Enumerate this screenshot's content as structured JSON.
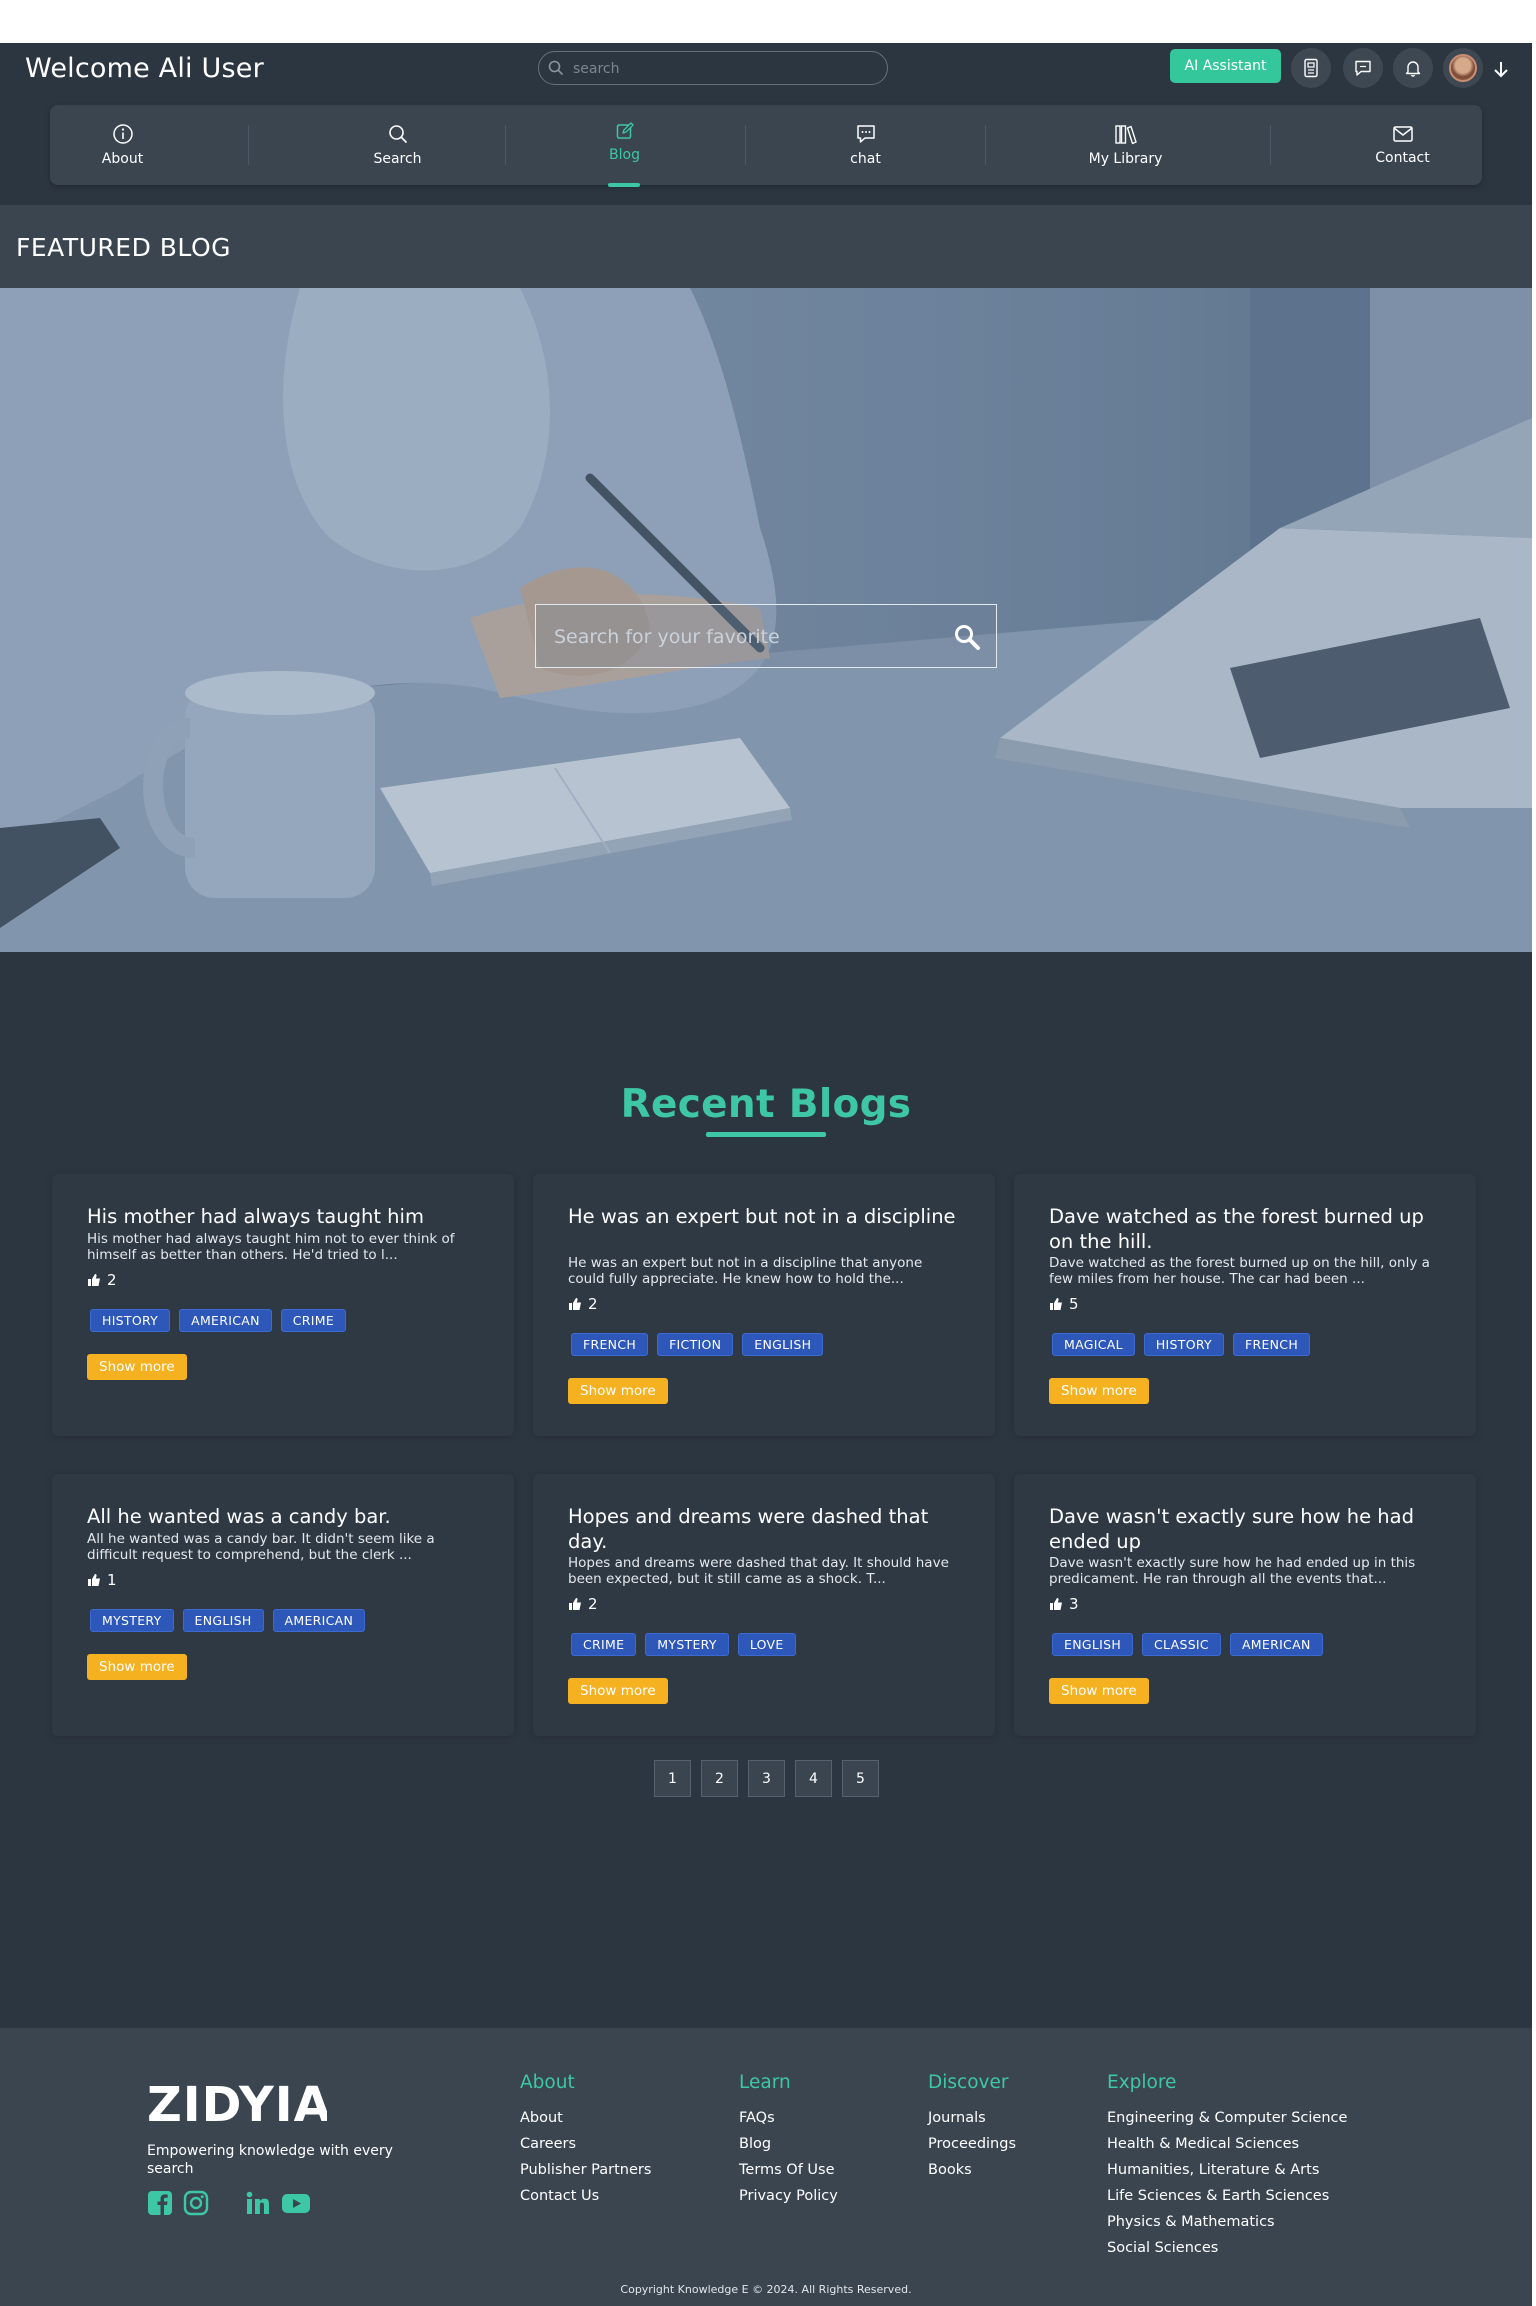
{
  "header": {
    "welcome": "Welcome Ali User",
    "search_placeholder": "search",
    "ai_button": "AI Assistant",
    "icons": [
      "document-icon",
      "message-icon",
      "bell-icon",
      "avatar",
      "arrow-down-icon"
    ]
  },
  "nav": {
    "items": [
      {
        "label": "About",
        "icon": "info-icon"
      },
      {
        "label": "Search",
        "icon": "search-icon"
      },
      {
        "label": "Blog",
        "icon": "edit-icon",
        "active": true
      },
      {
        "label": "chat",
        "icon": "chat-icon"
      },
      {
        "label": "My Library",
        "icon": "library-icon"
      },
      {
        "label": "Contact",
        "icon": "mail-icon"
      }
    ]
  },
  "featured": {
    "title": "FEATURED BLOG",
    "search_placeholder": "Search for your favorite"
  },
  "blogs": {
    "title": "Recent Blogs",
    "show_more": "Show more",
    "cards": [
      {
        "title": "His mother had always taught him",
        "excerpt": "His mother had always taught him not to ever think of himself as better than others. He'd tried to l...",
        "likes": "2",
        "tags": [
          "HISTORY",
          "AMERICAN",
          "CRIME"
        ]
      },
      {
        "title": "He was an expert but not in a discipline",
        "excerpt": "He was an expert but not in a discipline that anyone could fully appreciate. He knew how to hold the...",
        "likes": "2",
        "tags": [
          "FRENCH",
          "FICTION",
          "ENGLISH"
        ]
      },
      {
        "title": "Dave watched as the forest burned up on the hill.",
        "excerpt": "Dave watched as the forest burned up on the hill, only a few miles from her house. The car had been ...",
        "likes": "5",
        "tags": [
          "MAGICAL",
          "HISTORY",
          "FRENCH"
        ]
      },
      {
        "title": "All he wanted was a candy bar.",
        "excerpt": "All he wanted was a candy bar. It didn't seem like a difficult request to comprehend, but the clerk ...",
        "likes": "1",
        "tags": [
          "MYSTERY",
          "ENGLISH",
          "AMERICAN"
        ]
      },
      {
        "title": "Hopes and dreams were dashed that day.",
        "excerpt": "Hopes and dreams were dashed that day. It should have been expected, but it still came as a shock. T...",
        "likes": "2",
        "tags": [
          "CRIME",
          "MYSTERY",
          "LOVE"
        ]
      },
      {
        "title": "Dave wasn't exactly sure how he had ended up",
        "excerpt": "Dave wasn't exactly sure how he had ended up in this predicament. He ran through all the events that...",
        "likes": "3",
        "tags": [
          "ENGLISH",
          "CLASSIC",
          "AMERICAN"
        ]
      }
    ],
    "pages": [
      "1",
      "2",
      "3",
      "4",
      "5"
    ]
  },
  "footer": {
    "brand": "ZIDYIA",
    "tagline": "Empowering knowledge with every search",
    "socials": [
      "facebook-icon",
      "instagram-icon",
      "linkedin-icon",
      "youtube-icon"
    ],
    "columns": [
      {
        "title": "About",
        "links": [
          "About",
          "Careers",
          "Publisher Partners",
          "Contact Us"
        ]
      },
      {
        "title": "Learn",
        "links": [
          "FAQs",
          "Blog",
          "Terms Of Use",
          "Privacy Policy"
        ]
      },
      {
        "title": "Discover",
        "links": [
          "Journals",
          "Proceedings",
          "Books"
        ]
      },
      {
        "title": "Explore",
        "links": [
          "Engineering & Computer Science",
          "Health & Medical Sciences",
          "Humanities, Literature & Arts",
          "Life Sciences & Earth Sciences",
          "Physics & Mathematics",
          "Social Sciences"
        ]
      }
    ],
    "copyright": "Copyright Knowledge E © 2024. All Rights Reserved."
  },
  "colors": {
    "accent": "#3ec7a4",
    "background": "#2c3641",
    "tag": "#2d57b8",
    "button": "#f5b120"
  }
}
